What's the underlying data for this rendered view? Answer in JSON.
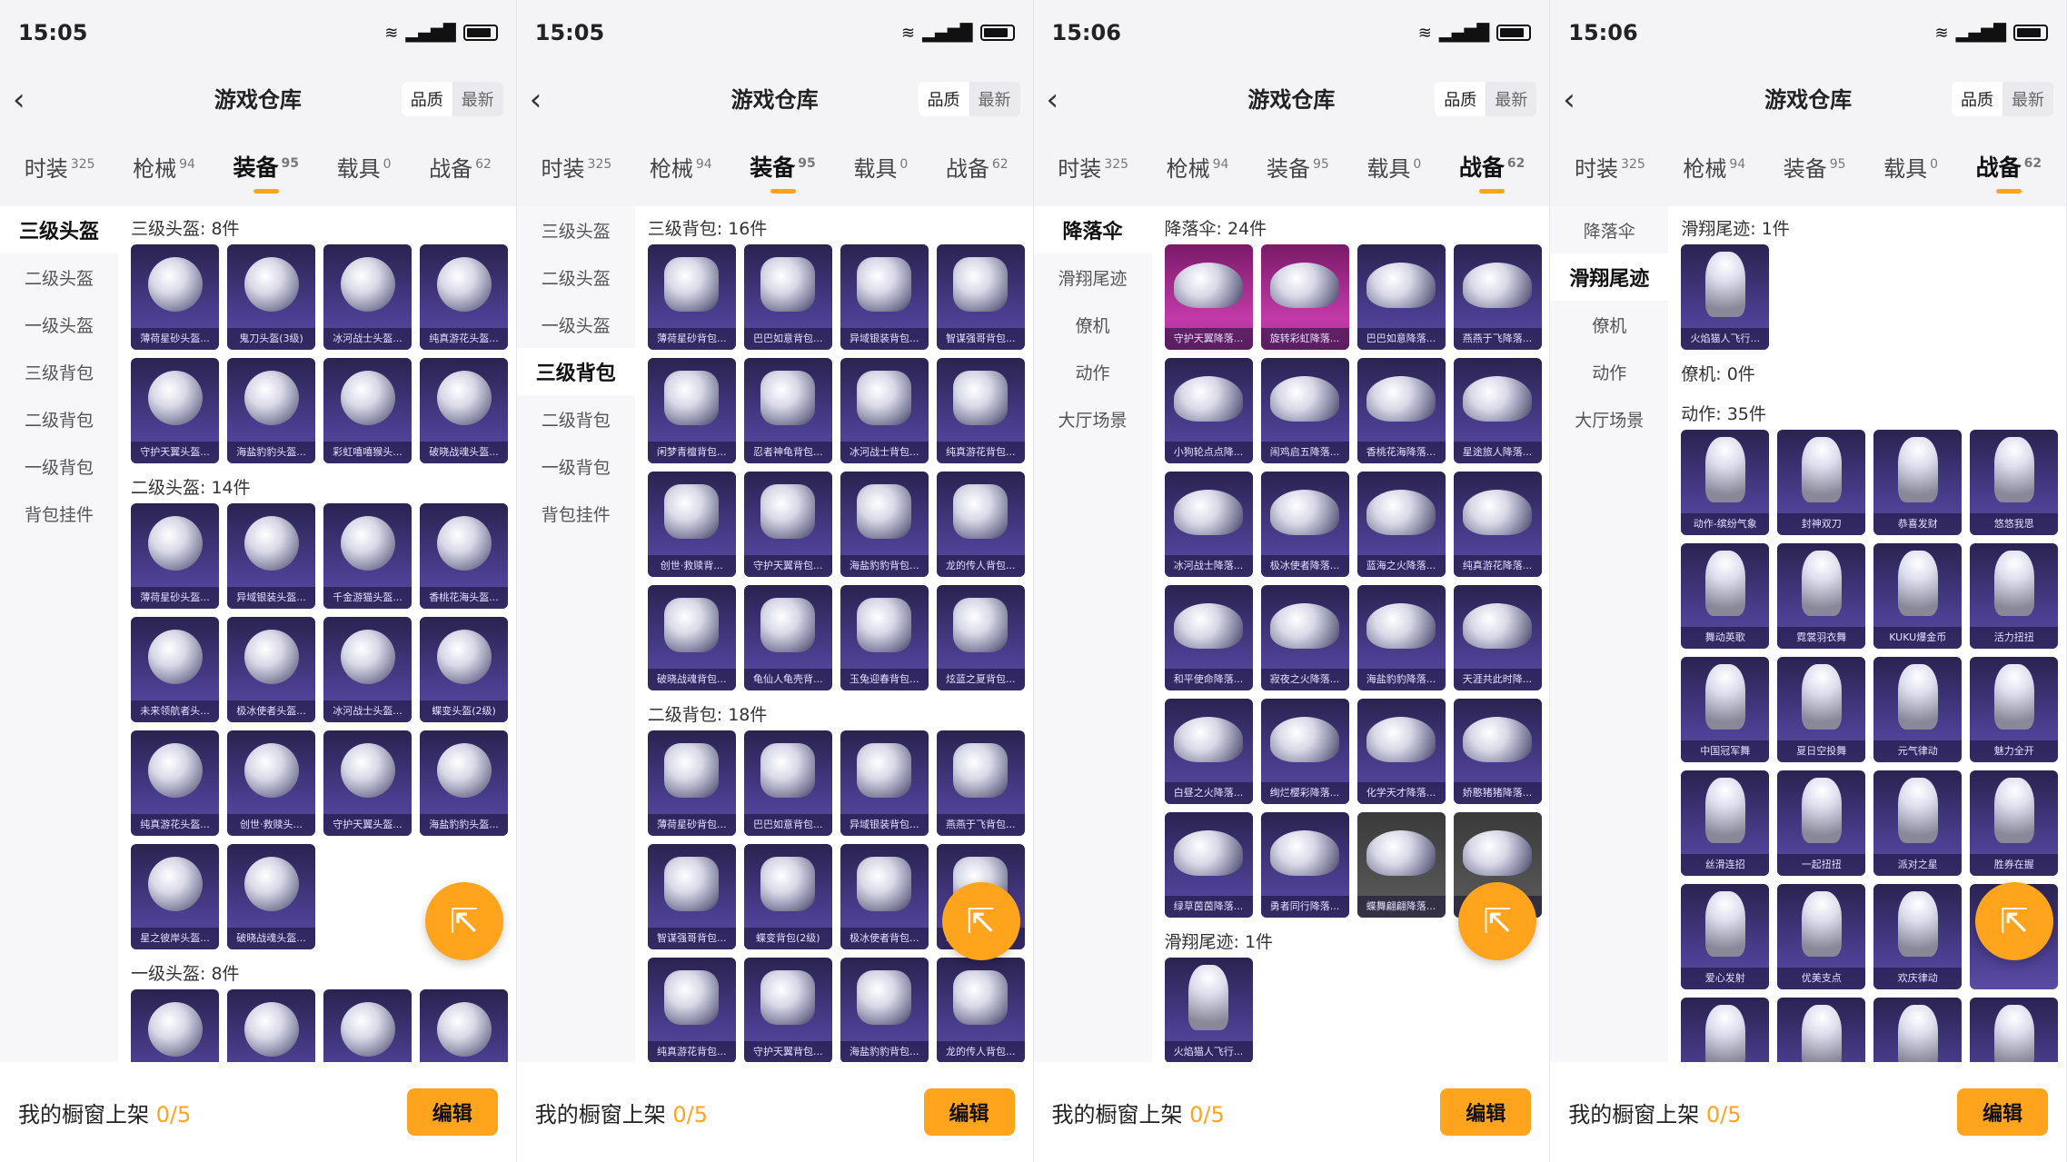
{
  "screens": [
    {
      "time": "15:05",
      "title": "游戏仓库",
      "sort": [
        "品质",
        "最新"
      ],
      "tabs": [
        [
          "时装",
          "325"
        ],
        [
          "枪械",
          "94"
        ],
        [
          "装备",
          "95"
        ],
        [
          "载具",
          "0"
        ],
        [
          "战备",
          "62"
        ]
      ],
      "active_tab": 2,
      "side": [
        "三级头盔",
        "二级头盔",
        "一级头盔",
        "三级背包",
        "二级背包",
        "一级背包",
        "背包挂件"
      ],
      "active_side": 0,
      "sections": [
        {
          "title": "三级头盔: 8件",
          "kind": "helm",
          "items": [
            "薄荷星砂头盔...",
            "鬼刀头盔(3级)",
            "冰河战士头盔...",
            "纯真游花头盔...",
            "守护天翼头盔...",
            "海盐豹豹头盔...",
            "彩虹嘻嘻猴头...",
            "破晓战魂头盔..."
          ]
        },
        {
          "title": "二级头盔: 14件",
          "kind": "helm",
          "items": [
            "薄荷星砂头盔...",
            "异域银装头盔...",
            "千金游猫头盔...",
            "香桃花海头盔...",
            "未来领航者头...",
            "极冰使者头盔...",
            "冰河战士头盔...",
            "蝶变头盔(2级)",
            "纯真游花头盔...",
            "创世·救赎头...",
            "守护天翼头盔...",
            "海盐豹豹头盔...",
            "星之彼岸头盔...",
            "破晓战魂头盔..."
          ]
        },
        {
          "title": "一级头盔: 8件",
          "kind": "helm",
          "items": [
            "",
            "",
            "",
            ""
          ]
        }
      ],
      "footer": {
        "label": "我的橱窗上架 ",
        "count": "0/5",
        "edit": "编辑"
      }
    },
    {
      "time": "15:05",
      "title": "游戏仓库",
      "sort": [
        "品质",
        "最新"
      ],
      "tabs": [
        [
          "时装",
          "325"
        ],
        [
          "枪械",
          "94"
        ],
        [
          "装备",
          "95"
        ],
        [
          "载具",
          "0"
        ],
        [
          "战备",
          "62"
        ]
      ],
      "active_tab": 2,
      "side": [
        "三级头盔",
        "二级头盔",
        "一级头盔",
        "三级背包",
        "二级背包",
        "一级背包",
        "背包挂件"
      ],
      "active_side": 3,
      "sections": [
        {
          "title": "三级背包: 16件",
          "kind": "bag",
          "items": [
            "薄荷星砂背包...",
            "巴巴如意背包...",
            "异域银装背包...",
            "智谋强哥背包...",
            "闲梦青檀背包...",
            "忍者神龟背包...",
            "冰河战士背包...",
            "纯真游花背包...",
            "创世·救赎背...",
            "守护天翼背包...",
            "海盐豹豹背包...",
            "龙的传人背包...",
            "破晓战魂背包...",
            "龟仙人龟壳背...",
            "玉兔迎春背包...",
            "炫蓝之夏背包..."
          ]
        },
        {
          "title": "二级背包: 18件",
          "kind": "bag",
          "items": [
            "薄荷星砂背包...",
            "巴巴如意背包...",
            "异域银装背包...",
            "燕燕于飞背包...",
            "智谋强哥背包...",
            "蝶变背包(2级)",
            "极冰使者背包...",
            "冰河战士背包...",
            "纯真游花背包...",
            "守护天翼背包...",
            "海盐豹豹背包...",
            "龙的传人背包..."
          ]
        }
      ],
      "footer": {
        "label": "我的橱窗上架 ",
        "count": "0/5",
        "edit": "编辑"
      }
    },
    {
      "time": "15:06",
      "title": "游戏仓库",
      "sort": [
        "品质",
        "最新"
      ],
      "tabs": [
        [
          "时装",
          "325"
        ],
        [
          "枪械",
          "94"
        ],
        [
          "装备",
          "95"
        ],
        [
          "载具",
          "0"
        ],
        [
          "战备",
          "62"
        ]
      ],
      "active_tab": 4,
      "side": [
        "降落伞",
        "滑翔尾迹",
        "僚机",
        "动作",
        "大厅场景"
      ],
      "active_side": 0,
      "sections": [
        {
          "title": "降落伞: 24件",
          "kind": "chute",
          "items": [
            "守护天翼降落...",
            "旋转彩虹降落...",
            "巴巴如意降落...",
            "燕燕于飞降落...",
            "小狗轮点点降...",
            "闹鸡启五降落...",
            "香桃花海降落...",
            "星途旅人降落...",
            "冰河战士降落...",
            "极冰使者降落...",
            "蓝海之火降落...",
            "纯真游花降落...",
            "和平使命降落...",
            "寂夜之火降落...",
            "海盐豹豹降落...",
            "天涯共此时降...",
            "白昼之火降落...",
            "绚烂樱彩降落...",
            "化学天才降落...",
            "娇憨猪猪降落...",
            "绿草茵茵降落...",
            "勇者同行降落...",
            "蝶舞翩翩降落...",
            "普通降落伞"
          ]
        },
        {
          "title": "滑翔尾迹: 1件",
          "kind": "trail",
          "items": [
            "火焰猫人飞行..."
          ]
        }
      ],
      "footer": {
        "label": "我的橱窗上架 ",
        "count": "0/5",
        "edit": "编辑"
      }
    },
    {
      "time": "15:06",
      "title": "游戏仓库",
      "sort": [
        "品质",
        "最新"
      ],
      "tabs": [
        [
          "时装",
          "325"
        ],
        [
          "枪械",
          "94"
        ],
        [
          "装备",
          "95"
        ],
        [
          "载具",
          "0"
        ],
        [
          "战备",
          "62"
        ]
      ],
      "active_tab": 4,
      "side": [
        "降落伞",
        "滑翔尾迹",
        "僚机",
        "动作",
        "大厅场景"
      ],
      "active_side": 1,
      "sections": [
        {
          "title": "滑翔尾迹: 1件",
          "kind": "trail",
          "items": [
            "火焰猫人飞行..."
          ]
        },
        {
          "title": "僚机: 0件",
          "kind": "fig",
          "items": []
        },
        {
          "title": "动作: 35件",
          "kind": "fig",
          "items": [
            "动作-缤纷气象",
            "封神双刀",
            "恭喜发财",
            "悠悠我思",
            "舞动英歌",
            "霓裳羽衣舞",
            "KUKU爆金币",
            "活力扭扭",
            "中国冠军舞",
            "夏日空投舞",
            "元气律动",
            "魅力全开",
            "丝滑连招",
            "一起扭扭",
            "派对之星",
            "胜券在握",
            "爱心发射",
            "优美支点",
            "欢庆律动",
            "",
            "",
            "",
            "",
            ""
          ]
        }
      ],
      "footer": {
        "label": "我的橱窗上架 ",
        "count": "0/5",
        "edit": "编辑"
      }
    }
  ]
}
